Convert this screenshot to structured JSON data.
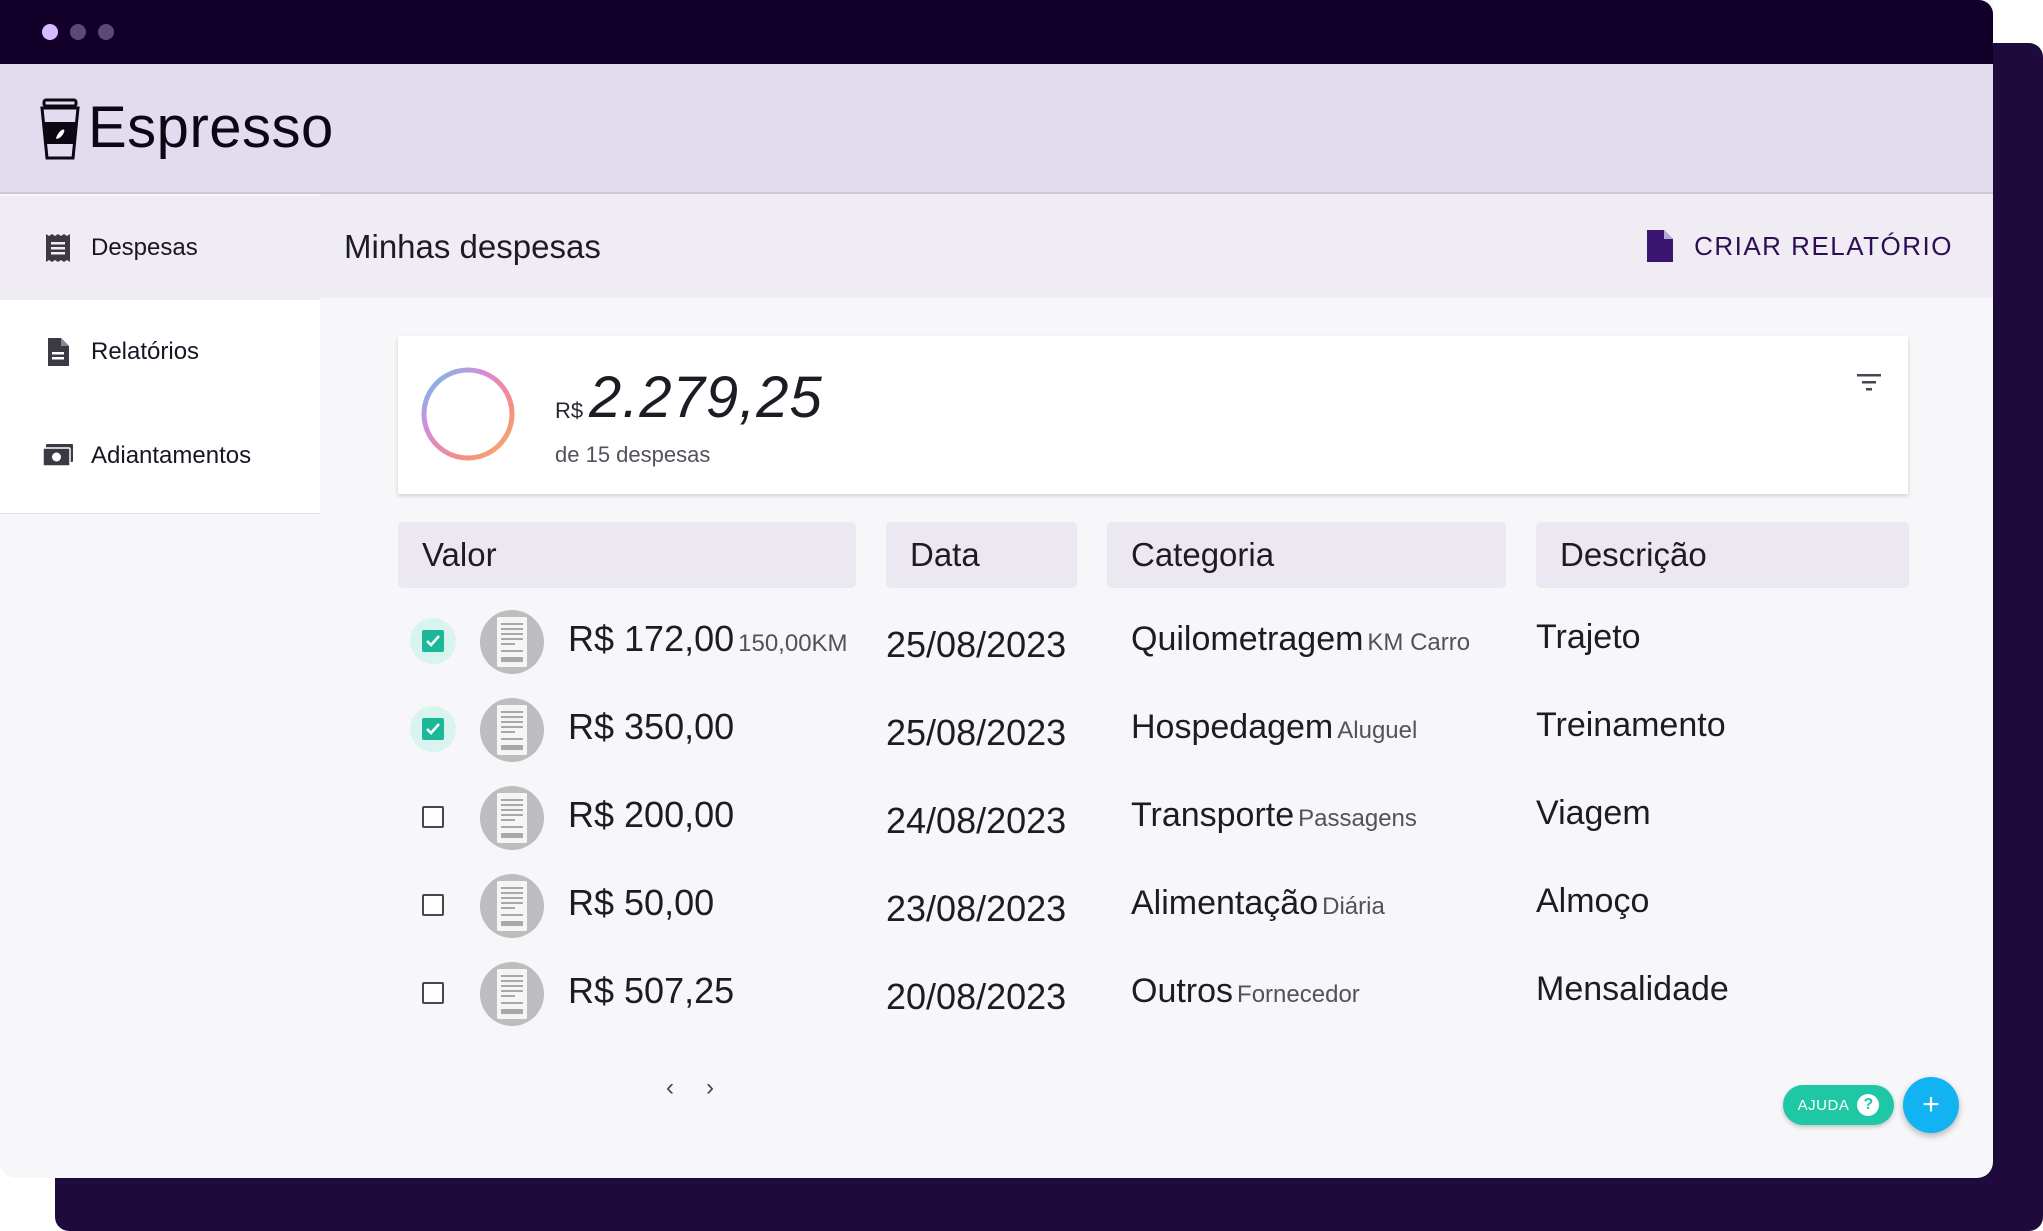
{
  "app": {
    "name": "Espresso",
    "logo_icon": "coffee-cup-icon"
  },
  "sidebar": {
    "items": [
      {
        "label": "Despesas",
        "icon": "receipt-list-icon",
        "active": true
      },
      {
        "label": "Relatórios",
        "icon": "document-icon",
        "active": false
      },
      {
        "label": "Adiantamentos",
        "icon": "money-icon",
        "active": false
      }
    ]
  },
  "header": {
    "title": "Minhas despesas",
    "create_report_label": "CRIAR RELATÓRIO",
    "create_report_icon": "file-icon"
  },
  "summary": {
    "currency": "R$",
    "total": "2.279,25",
    "subtitle": "de 15 despesas",
    "filter_icon": "filter-icon"
  },
  "table": {
    "columns": [
      "Valor",
      "Data",
      "Categoria",
      "Descrição"
    ],
    "rows": [
      {
        "checked": true,
        "value": "R$ 172,00",
        "value_sub": "150,00KM",
        "date": "25/08/2023",
        "category": "Quilometragem",
        "category_sub": "KM Carro",
        "description": "Trajeto"
      },
      {
        "checked": true,
        "value": "R$ 350,00",
        "value_sub": "",
        "date": "25/08/2023",
        "category": "Hospedagem",
        "category_sub": "Aluguel",
        "description": "Treinamento"
      },
      {
        "checked": false,
        "value": "R$ 200,00",
        "value_sub": "",
        "date": "24/08/2023",
        "category": "Transporte",
        "category_sub": "Passagens",
        "description": "Viagem"
      },
      {
        "checked": false,
        "value": "R$ 50,00",
        "value_sub": "",
        "date": "23/08/2023",
        "category": "Alimentação",
        "category_sub": "Diária",
        "description": "Almoço"
      },
      {
        "checked": false,
        "value": "R$ 507,25",
        "value_sub": "",
        "date": "20/08/2023",
        "category": "Outros",
        "category_sub": "Fornecedor",
        "description": "Mensalidade"
      }
    ]
  },
  "pagination": {
    "prev": "‹",
    "next": "›"
  },
  "help": {
    "label": "AJUDA",
    "symbol": "?"
  },
  "fab": {
    "symbol": "+"
  },
  "colors": {
    "brand_dark": "#12002a",
    "appbar": "#e3dcef",
    "accent_purple": "#3b1670",
    "check_green": "#1bb89a",
    "fab_blue": "#11b3f2",
    "help_green": "#1ec8a5"
  }
}
